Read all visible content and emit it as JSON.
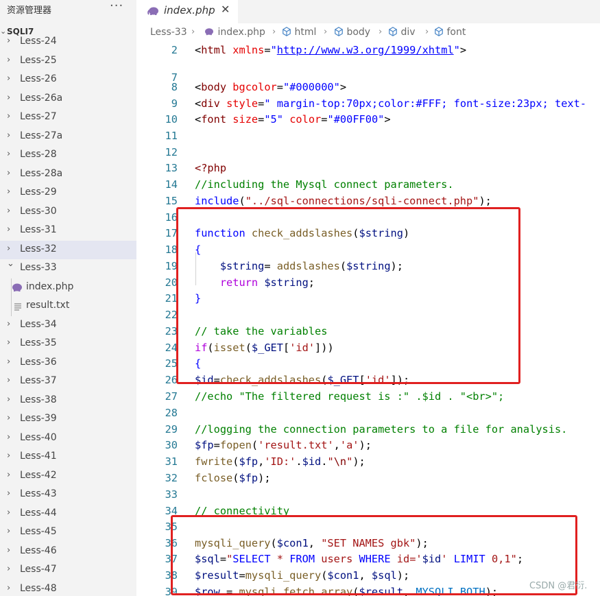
{
  "sidebar": {
    "title": "资源管理器",
    "more": "···",
    "root": "SQLI7",
    "items": [
      {
        "label": "Less-24"
      },
      {
        "label": "Less-25"
      },
      {
        "label": "Less-26"
      },
      {
        "label": "Less-26a"
      },
      {
        "label": "Less-27"
      },
      {
        "label": "Less-27a"
      },
      {
        "label": "Less-28"
      },
      {
        "label": "Less-28a"
      },
      {
        "label": "Less-29"
      },
      {
        "label": "Less-30"
      },
      {
        "label": "Less-31"
      },
      {
        "label": "Less-32"
      },
      {
        "label": "Less-33"
      },
      {
        "label": "index.php"
      },
      {
        "label": "result.txt"
      },
      {
        "label": "Less-34"
      },
      {
        "label": "Less-35"
      },
      {
        "label": "Less-36"
      },
      {
        "label": "Less-37"
      },
      {
        "label": "Less-38"
      },
      {
        "label": "Less-39"
      },
      {
        "label": "Less-40"
      },
      {
        "label": "Less-41"
      },
      {
        "label": "Less-42"
      },
      {
        "label": "Less-43"
      },
      {
        "label": "Less-44"
      },
      {
        "label": "Less-45"
      },
      {
        "label": "Less-46"
      },
      {
        "label": "Less-47"
      },
      {
        "label": "Less-48"
      }
    ]
  },
  "tab": {
    "label": "index.php",
    "close": "✕"
  },
  "breadcrumb": [
    "Less-33",
    "index.php",
    "html",
    "body",
    "div",
    "font"
  ],
  "code": [
    {
      "n": "2",
      "t": [
        [
          "tk-plain",
          "<"
        ],
        [
          "tk-tag",
          "html"
        ],
        [
          "tk-plain",
          " "
        ],
        [
          "tk-attr",
          "xmlns"
        ],
        [
          "tk-plain",
          "="
        ],
        [
          "tk-str",
          "\""
        ],
        [
          "tk-link",
          "http://www.w3.org/1999/xhtml"
        ],
        [
          "tk-str",
          "\""
        ],
        [
          "tk-plain",
          ">"
        ]
      ]
    },
    {
      "n": "7",
      "t": []
    },
    {
      "n": "8",
      "t": [
        [
          "tk-plain",
          "<"
        ],
        [
          "tk-tag",
          "body"
        ],
        [
          "tk-plain",
          " "
        ],
        [
          "tk-attr",
          "bgcolor"
        ],
        [
          "tk-plain",
          "="
        ],
        [
          "tk-str",
          "\"#000000\""
        ],
        [
          "tk-plain",
          ">"
        ]
      ]
    },
    {
      "n": "9",
      "t": [
        [
          "tk-plain",
          "<"
        ],
        [
          "tk-tag",
          "div"
        ],
        [
          "tk-plain",
          " "
        ],
        [
          "tk-attr",
          "style"
        ],
        [
          "tk-plain",
          "="
        ],
        [
          "tk-str",
          "\" margin-top:70px;color:#FFF; font-size:23px; text-"
        ]
      ]
    },
    {
      "n": "10",
      "t": [
        [
          "tk-plain",
          "<"
        ],
        [
          "tk-tag",
          "font"
        ],
        [
          "tk-plain",
          " "
        ],
        [
          "tk-attr",
          "size"
        ],
        [
          "tk-plain",
          "="
        ],
        [
          "tk-str",
          "\"5\""
        ],
        [
          "tk-plain",
          " "
        ],
        [
          "tk-attr",
          "color"
        ],
        [
          "tk-plain",
          "="
        ],
        [
          "tk-str",
          "\"#00FF00\""
        ],
        [
          "tk-plain",
          ">"
        ]
      ]
    },
    {
      "n": "11",
      "t": []
    },
    {
      "n": "12",
      "t": []
    },
    {
      "n": "13",
      "t": [
        [
          "tk-php",
          "<?php"
        ]
      ]
    },
    {
      "n": "14",
      "t": [
        [
          "tk-com",
          "//including the Mysql connect parameters."
        ]
      ]
    },
    {
      "n": "15",
      "t": [
        [
          "tk-kw",
          "include"
        ],
        [
          "tk-plain",
          "("
        ],
        [
          "tk-strred",
          "\"../sql-connections/sqli-connect.php\""
        ],
        [
          "tk-plain",
          ");"
        ]
      ]
    },
    {
      "n": "16",
      "t": []
    },
    {
      "n": "17",
      "t": [
        [
          "tk-kw",
          "function"
        ],
        [
          "tk-plain",
          " "
        ],
        [
          "tk-fn",
          "check_addslashes"
        ],
        [
          "tk-plain",
          "("
        ],
        [
          "tk-var",
          "$string"
        ],
        [
          "tk-plain",
          ")"
        ]
      ]
    },
    {
      "n": "18",
      "t": [
        [
          "tk-kw",
          "{"
        ]
      ]
    },
    {
      "n": "19",
      "t": [
        [
          "tk-plain",
          "    "
        ],
        [
          "tk-var",
          "$string"
        ],
        [
          "tk-plain",
          "= "
        ],
        [
          "tk-fn",
          "addslashes"
        ],
        [
          "tk-plain",
          "("
        ],
        [
          "tk-var",
          "$string"
        ],
        [
          "tk-plain",
          ");"
        ]
      ]
    },
    {
      "n": "20",
      "t": [
        [
          "tk-plain",
          "    "
        ],
        [
          "tk-ctl",
          "return"
        ],
        [
          "tk-plain",
          " "
        ],
        [
          "tk-var",
          "$string"
        ],
        [
          "tk-plain",
          ";"
        ]
      ]
    },
    {
      "n": "21",
      "t": [
        [
          "tk-kw",
          "}"
        ]
      ]
    },
    {
      "n": "22",
      "t": []
    },
    {
      "n": "23",
      "t": [
        [
          "tk-com",
          "// take the variables"
        ]
      ]
    },
    {
      "n": "24",
      "t": [
        [
          "tk-ctl",
          "if"
        ],
        [
          "tk-plain",
          "("
        ],
        [
          "tk-fn",
          "isset"
        ],
        [
          "tk-plain",
          "("
        ],
        [
          "tk-var",
          "$_GET"
        ],
        [
          "tk-plain",
          "["
        ],
        [
          "tk-strred",
          "'id'"
        ],
        [
          "tk-plain",
          "]))"
        ]
      ]
    },
    {
      "n": "25",
      "t": [
        [
          "tk-kw",
          "{"
        ]
      ]
    },
    {
      "n": "26",
      "t": [
        [
          "tk-var",
          "$id"
        ],
        [
          "tk-plain",
          "="
        ],
        [
          "tk-fn",
          "check_addslashes"
        ],
        [
          "tk-plain",
          "("
        ],
        [
          "tk-var",
          "$_GET"
        ],
        [
          "tk-plain",
          "["
        ],
        [
          "tk-strred",
          "'id'"
        ],
        [
          "tk-plain",
          "]);"
        ]
      ]
    },
    {
      "n": "27",
      "t": [
        [
          "tk-com",
          "//echo \"The filtered request is :\" .$id . \"<br>\";"
        ]
      ]
    },
    {
      "n": "28",
      "t": []
    },
    {
      "n": "29",
      "t": [
        [
          "tk-com",
          "//logging the connection parameters to a file for analysis."
        ]
      ]
    },
    {
      "n": "30",
      "t": [
        [
          "tk-var",
          "$fp"
        ],
        [
          "tk-plain",
          "="
        ],
        [
          "tk-fn",
          "fopen"
        ],
        [
          "tk-plain",
          "("
        ],
        [
          "tk-strred",
          "'result.txt'"
        ],
        [
          "tk-plain",
          ","
        ],
        [
          "tk-strred",
          "'a'"
        ],
        [
          "tk-plain",
          ");"
        ]
      ]
    },
    {
      "n": "31",
      "t": [
        [
          "tk-fn",
          "fwrite"
        ],
        [
          "tk-plain",
          "("
        ],
        [
          "tk-var",
          "$fp"
        ],
        [
          "tk-plain",
          ","
        ],
        [
          "tk-strred",
          "'ID:'"
        ],
        [
          "tk-plain",
          "."
        ],
        [
          "tk-var",
          "$id"
        ],
        [
          "tk-plain",
          "."
        ],
        [
          "tk-strred",
          "\""
        ],
        [
          "tk-tag",
          "\\n"
        ],
        [
          "tk-strred",
          "\""
        ],
        [
          "tk-plain",
          ");"
        ]
      ]
    },
    {
      "n": "32",
      "t": [
        [
          "tk-fn",
          "fclose"
        ],
        [
          "tk-plain",
          "("
        ],
        [
          "tk-var",
          "$fp"
        ],
        [
          "tk-plain",
          ");"
        ]
      ]
    },
    {
      "n": "33",
      "t": []
    },
    {
      "n": "34",
      "t": [
        [
          "tk-com",
          "// connectivity"
        ]
      ]
    },
    {
      "n": "35",
      "t": []
    },
    {
      "n": "36",
      "t": [
        [
          "tk-fn",
          "mysqli_query"
        ],
        [
          "tk-plain",
          "("
        ],
        [
          "tk-var",
          "$con1"
        ],
        [
          "tk-plain",
          ", "
        ],
        [
          "tk-strred",
          "\"SET NAMES gbk\""
        ],
        [
          "tk-plain",
          ");"
        ]
      ]
    },
    {
      "n": "37",
      "t": [
        [
          "tk-var",
          "$sql"
        ],
        [
          "tk-plain",
          "="
        ],
        [
          "tk-strred",
          "\""
        ],
        [
          "tk-sql",
          "SELECT"
        ],
        [
          "tk-strred",
          " * "
        ],
        [
          "tk-sql",
          "FROM"
        ],
        [
          "tk-strred",
          " users "
        ],
        [
          "tk-sql",
          "WHERE"
        ],
        [
          "tk-strred",
          " id='"
        ],
        [
          "tk-var",
          "$id"
        ],
        [
          "tk-strred",
          "' "
        ],
        [
          "tk-sql",
          "LIMIT"
        ],
        [
          "tk-strred",
          " 0,1\""
        ],
        [
          "tk-plain",
          ";"
        ]
      ]
    },
    {
      "n": "38",
      "t": [
        [
          "tk-var",
          "$result"
        ],
        [
          "tk-plain",
          "="
        ],
        [
          "tk-fn",
          "mysqli_query"
        ],
        [
          "tk-plain",
          "("
        ],
        [
          "tk-var",
          "$con1"
        ],
        [
          "tk-plain",
          ", "
        ],
        [
          "tk-var",
          "$sql"
        ],
        [
          "tk-plain",
          ");"
        ]
      ]
    },
    {
      "n": "39",
      "t": [
        [
          "tk-var",
          "$row"
        ],
        [
          "tk-plain",
          " = "
        ],
        [
          "tk-fn",
          "mysqli_fetch_array"
        ],
        [
          "tk-plain",
          "("
        ],
        [
          "tk-var",
          "$result"
        ],
        [
          "tk-plain",
          ", "
        ],
        [
          "tk-const",
          "MYSQLI_BOTH"
        ],
        [
          "tk-plain",
          ");"
        ]
      ]
    }
  ],
  "watermark": "CSDN @君衍."
}
